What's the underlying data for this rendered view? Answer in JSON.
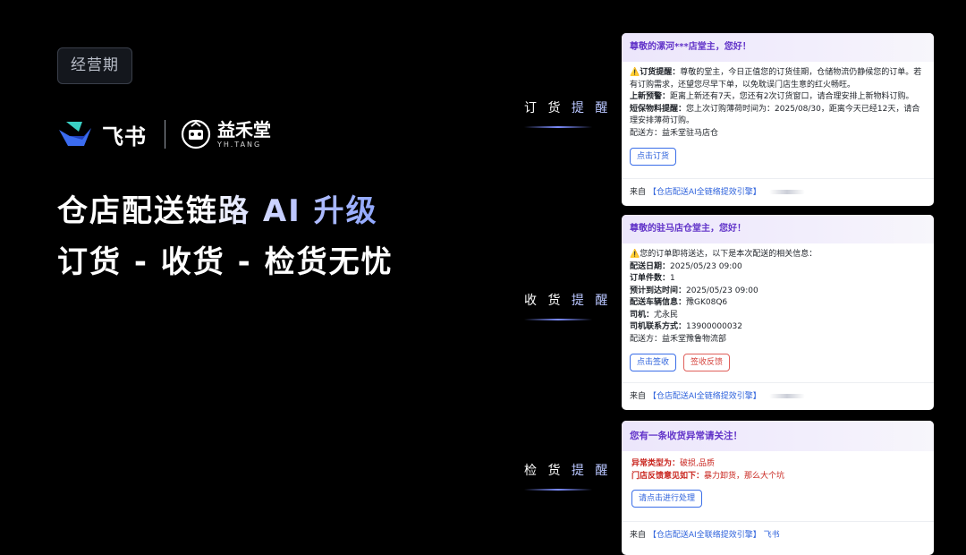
{
  "badge": "经营期",
  "brand": {
    "feishu": "飞书",
    "partner_cn": "益禾堂",
    "partner_en": "YH.TANG"
  },
  "headline": "仓店配送链路 AI 升级",
  "subline": "订货 - 收货 - 检货无忧",
  "steps": [
    {
      "prefix": "订 货 ",
      "accent": "提 醒"
    },
    {
      "prefix": "收 货 ",
      "accent": "提 醒"
    },
    {
      "prefix": "检 货 ",
      "accent": "提 醒"
    }
  ],
  "cards": {
    "order": {
      "title": "尊敬的漯河***店堂主，您好！",
      "line1_label": "⚠️订货提醒：",
      "line1_text": "尊敬的堂主，今日正值您的订货佳期，仓储物流仍静候您的订单。若有订购需求，还望您尽早下单，以免耽误门店生意的红火畅旺。",
      "line2_label": "上新预警：",
      "line2_text": "距离上新还有7天，您还有2次订货窗口，请合理安排上新物料订购。",
      "line3_label": "短保物料提醒：",
      "line3_text": "您上次订购薄荷时间为：2025/08/30，距离今天已经12天，请合理安排薄荷订购。",
      "line4": "配送方：益禾堂驻马店仓",
      "button": "点击订货",
      "footer_prefix": "来自",
      "footer_source": "【仓店配送AI全链络提效引擎】"
    },
    "receive": {
      "title": "尊敬的驻马店仓堂主，您好！",
      "intro": "⚠️您的订单即将送达，以下是本次配送的相关信息：",
      "rows": [
        {
          "label": "配送日期：",
          "value": "2025/05/23 09:00"
        },
        {
          "label": "订单件数：",
          "value": "1"
        },
        {
          "label": "预计到达时间：",
          "value": "2025/05/23 09:00"
        },
        {
          "label": "配送车辆信息：",
          "value": "豫GK08Q6"
        },
        {
          "label": "司机：",
          "value": "尤永民"
        },
        {
          "label": "司机联系方式：",
          "value": "13900000032"
        }
      ],
      "carrier": "配送方：益禾堂豫鲁物流部",
      "button_primary": "点击签收",
      "button_secondary": "签收反馈",
      "footer_prefix": "来自",
      "footer_source": "【仓店配送AI全链络提效引擎】"
    },
    "inspect": {
      "title": "您有一条收货异常请关注！",
      "line1_label": "异常类型为：",
      "line1_value": "破损,品质",
      "line2_label": "门店反馈意见如下：",
      "line2_value": "暴力卸货，那么大个坑",
      "button": "请点击进行处理",
      "footer_prefix": "来自",
      "footer_source": "【仓店配送AI全联络提效引擎】",
      "footer_app": "飞书"
    }
  },
  "colors": {
    "background": "#000000",
    "card_title": "#6234c9",
    "link": "#2f63dc",
    "danger": "#c9261f",
    "accent": "#8fa7ff"
  }
}
